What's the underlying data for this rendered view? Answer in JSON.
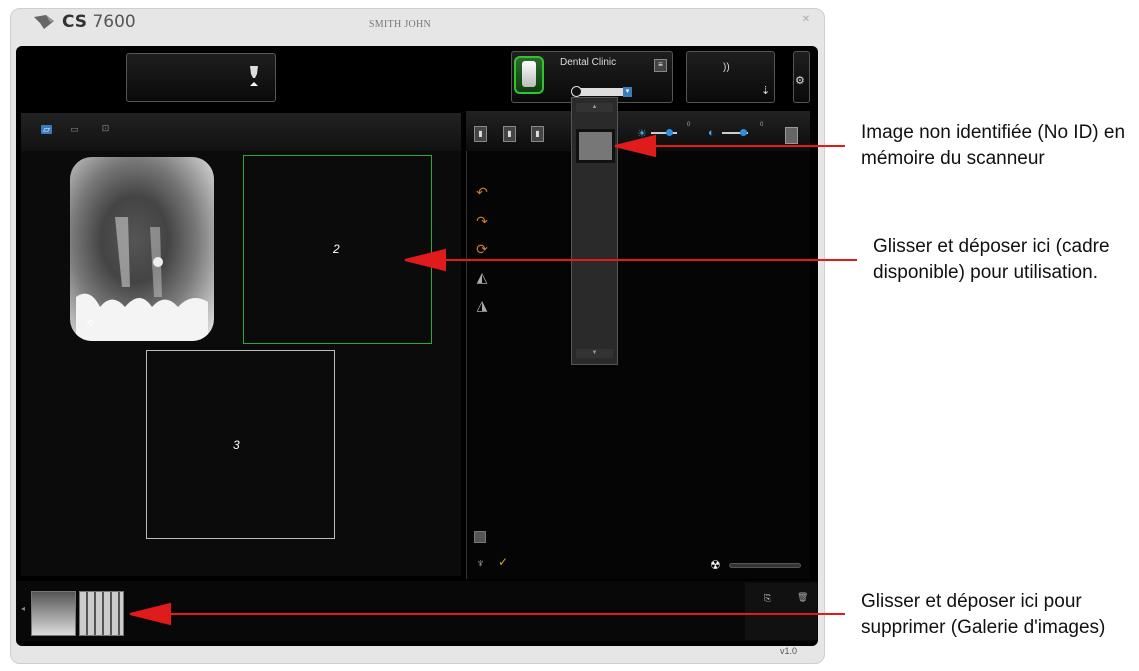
{
  "titlebar": {
    "brand_prefix": "CS",
    "brand_model": "7600",
    "patient_name": "SMITH JOHN",
    "close_glyph": "✕"
  },
  "header": {
    "clinic_label": "Dental Clinic",
    "menu_glyph": "≡",
    "dropdown_glyph": "▾",
    "tooth_glyph": "⏶",
    "wifi_glyph": "))",
    "usb_glyph": "⇣",
    "settings_glyph": "⚙"
  },
  "left_toolbar": {
    "icons": [
      "layout-icon",
      "image-icon",
      "add-image-icon"
    ]
  },
  "slots": [
    {
      "label": "2",
      "status": "available"
    },
    {
      "label": "3",
      "status": "available"
    }
  ],
  "right_toolbar": {
    "brightness_value": "0",
    "contrast_value": "0",
    "brightness_glyph": "☀",
    "contrast_glyph": "◐"
  },
  "memory": {
    "up_glyph": "▲",
    "down_glyph": "▼"
  },
  "gallery": {
    "prev_glyph": "◂",
    "version": "v1.0"
  },
  "annotations": [
    "Image non identifiée (No ID) en mémoire du scanneur",
    "Glisser et déposer ici (cadre disponible) pour utilisation.",
    "Glisser et déposer ici pour supprimer (Galerie d'images)"
  ],
  "colors": {
    "annotation_arrow": "#e01b1b",
    "available_slot": "#2ea83a",
    "accent_blue": "#3a7cc0"
  }
}
